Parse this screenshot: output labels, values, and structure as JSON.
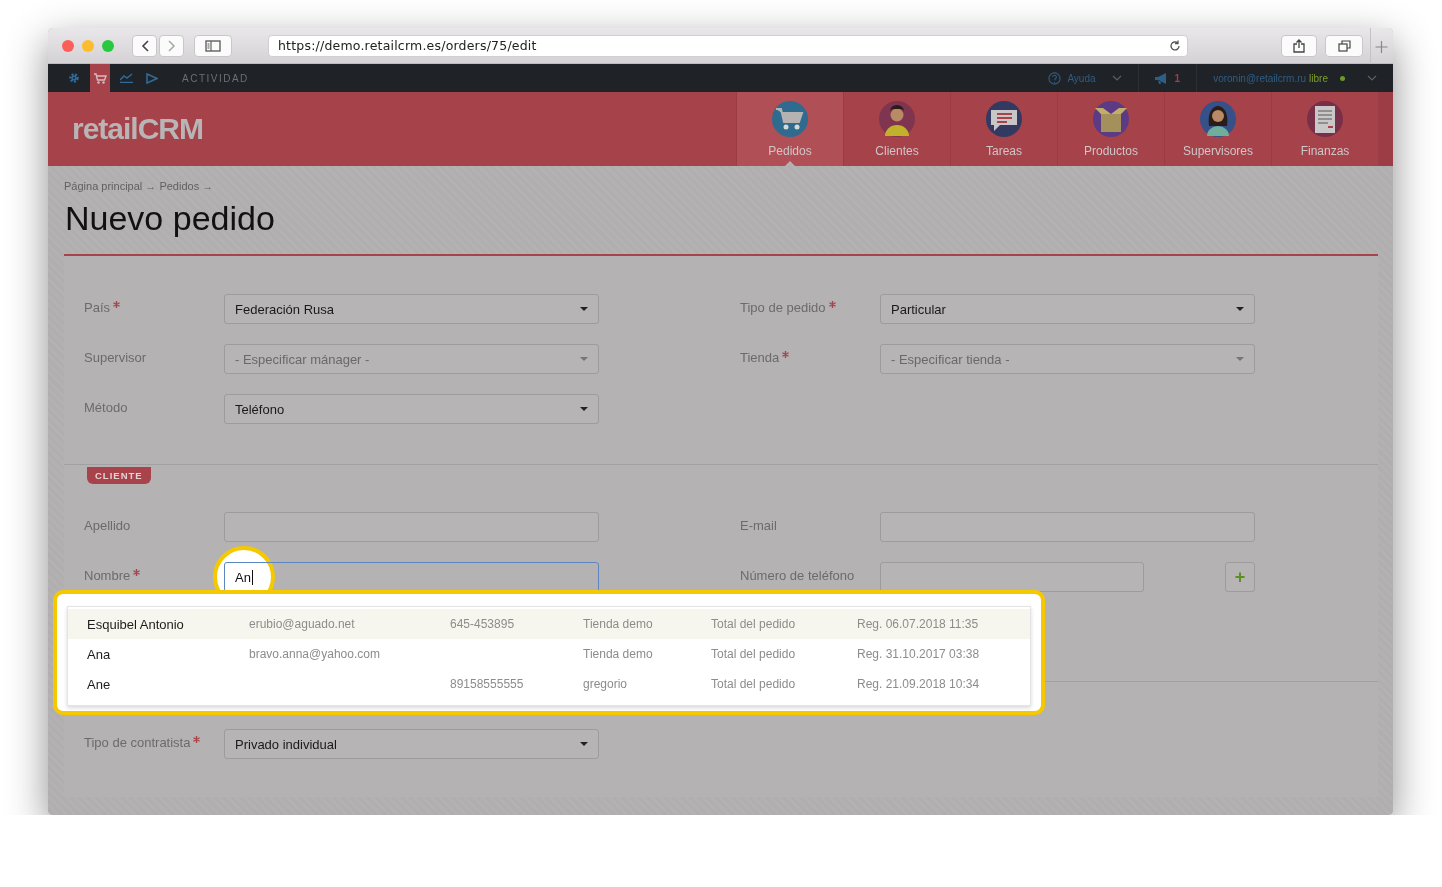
{
  "browser": {
    "url": "https://demo.retailcrm.es/orders/75/edit"
  },
  "topbar": {
    "apps": [
      {
        "kind": "gear",
        "selected": false
      },
      {
        "kind": "cart",
        "selected": true
      },
      {
        "kind": "chart",
        "selected": false
      },
      {
        "kind": "play",
        "selected": false
      }
    ],
    "section": "ACTIVIDAD",
    "help": "Ayuda",
    "notifications": "1",
    "user": "voronin@retailcrm.ru",
    "status": "libre"
  },
  "header": {
    "logo": "retailCRM",
    "nav": [
      {
        "label": "Pedidos",
        "kind": "cart",
        "selected": true
      },
      {
        "label": "Clientes",
        "kind": "man",
        "selected": false
      },
      {
        "label": "Tareas",
        "kind": "chat",
        "selected": false
      },
      {
        "label": "Productos",
        "kind": "box",
        "selected": false
      },
      {
        "label": "Supervisores",
        "kind": "woman",
        "selected": false
      },
      {
        "label": "Finanzas",
        "kind": "paper",
        "selected": false
      }
    ]
  },
  "breadcrumbs": "Página principal → Pedidos →",
  "title": "Nuevo pedido",
  "order_fields": [
    {
      "label": "País",
      "required": true,
      "kind": "select",
      "value": "Federación Rusa"
    },
    {
      "label": "Tipo de pedido",
      "required": true,
      "kind": "select",
      "value": "Particular"
    },
    {
      "label": "Supervisor",
      "required": false,
      "kind": "select",
      "placeholder": "- Especificar mánager -"
    },
    {
      "label": "Tienda",
      "required": true,
      "kind": "select",
      "placeholder": "- Especificar tienda -"
    },
    {
      "label": "Método",
      "required": false,
      "kind": "select",
      "value": "Teléfono"
    }
  ],
  "client": {
    "badge": "CLIENTE",
    "fields": [
      {
        "label": "Apellido",
        "required": false,
        "kind": "input"
      },
      {
        "label": "E-mail",
        "required": false,
        "kind": "input"
      },
      {
        "label": "Nombre",
        "required": true,
        "kind": "input",
        "value": "An",
        "focused": true
      },
      {
        "label": "Número de teléfono",
        "required": false,
        "kind": "phone",
        "add": "+"
      }
    ]
  },
  "autocomplete": [
    {
      "name": "Esquibel Antonio",
      "email": "erubio@aguado.net",
      "phone": "645-453895",
      "store": "Tienda demo",
      "total": "Total del pedido",
      "registered": "Reg. 06.07.2018 11:35",
      "selected": true
    },
    {
      "name": "Ana",
      "email": "bravo.anna@yahoo.com",
      "store": "Tienda demo",
      "total": "Total del pedido",
      "registered": "Reg. 31.10.2017 03:38",
      "selected": false
    },
    {
      "name": "Ane",
      "phone": "89158555555",
      "store": "gregorio",
      "total": "Total del pedido",
      "registered": "Reg. 21.09.2018 10:34",
      "selected": false
    }
  ],
  "contractor": {
    "label": "Tipo de contratista",
    "required": true,
    "kind": "select",
    "value": "Privado individual"
  }
}
